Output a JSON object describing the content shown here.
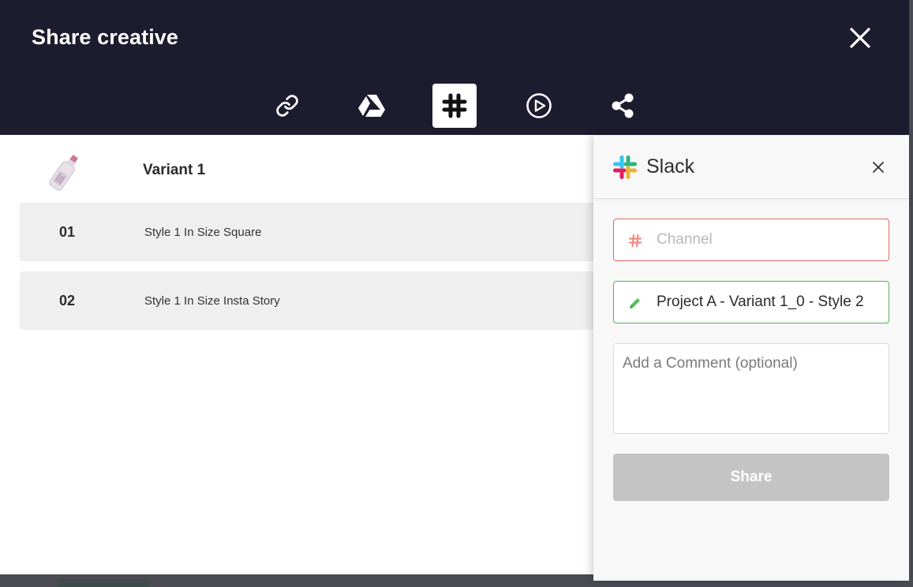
{
  "modal": {
    "title": "Share creative",
    "tabs": [
      {
        "icon": "link-icon",
        "active": false
      },
      {
        "icon": "google-drive-icon",
        "active": false
      },
      {
        "icon": "slack-icon",
        "active": true
      },
      {
        "icon": "play-circle-icon",
        "active": false
      },
      {
        "icon": "share-icon",
        "active": false
      }
    ]
  },
  "variant": {
    "name": "Variant 1",
    "items": [
      {
        "number": "01",
        "description": "Style 1 In Size Square"
      },
      {
        "number": "02",
        "description": "Style 1 In Size Insta Story"
      }
    ]
  },
  "slack_panel": {
    "title": "Slack",
    "channel_placeholder": "Channel",
    "title_value": "Project A - Variant 1_0 - Style 2",
    "comment_placeholder": "Add a Comment (optional)",
    "share_label": "Share"
  },
  "colors": {
    "header_bg": "#1d1b2e",
    "error_border": "#e06a63",
    "success_border": "#56b05a",
    "disabled_button": "#c4c4c4"
  }
}
